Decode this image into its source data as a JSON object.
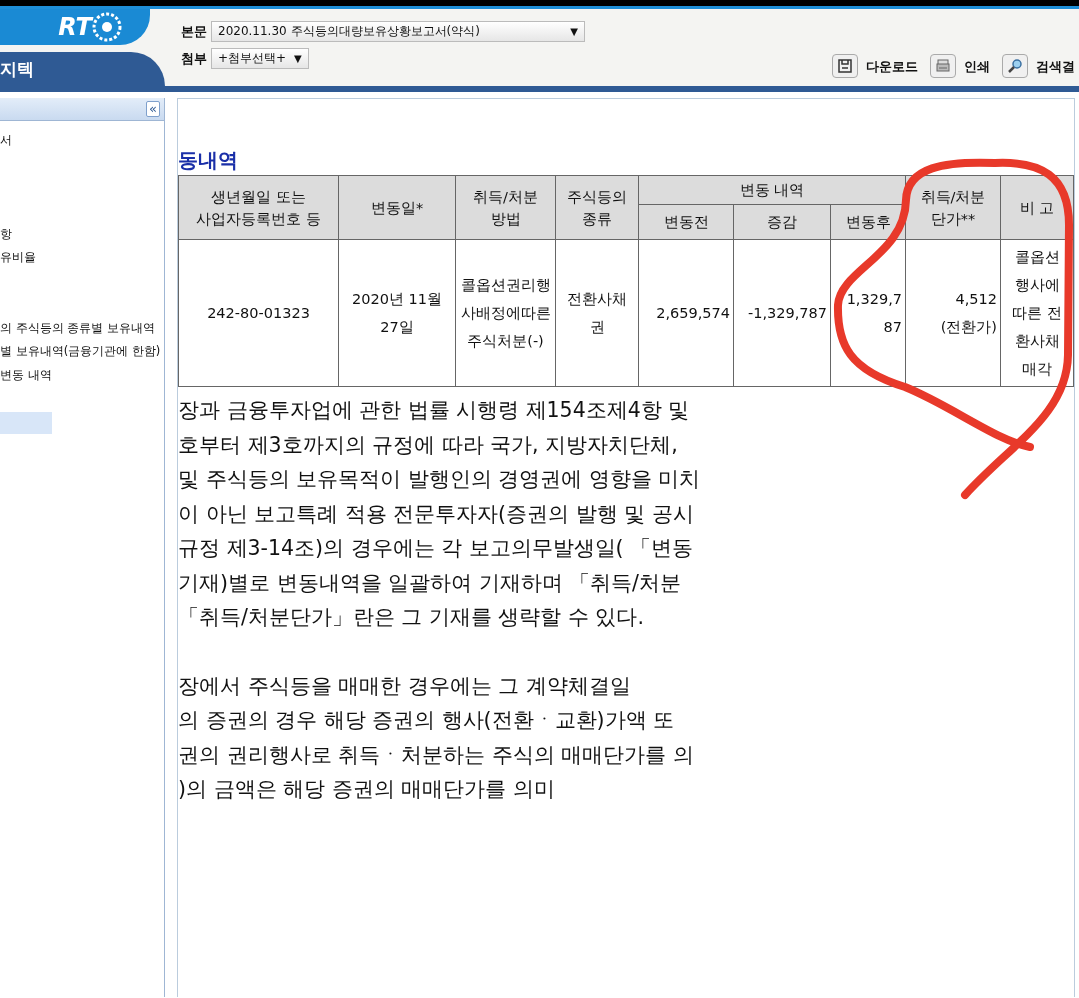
{
  "header": {
    "logo": "RT",
    "company": "지텍",
    "body_label": "본문",
    "body_select": "2020.11.30  주식등의대량보유상황보고서(약식)",
    "attach_label": "첨부",
    "attach_select": "+첨부선택+",
    "select_caret": "▼",
    "actions": [
      {
        "kind": "save",
        "label": "다운로드"
      },
      {
        "kind": "print",
        "label": "인쇄"
      },
      {
        "kind": "search",
        "label": "검색결"
      }
    ]
  },
  "sidebar": {
    "collapse": "«",
    "items": [
      {
        "label": "서"
      },
      {
        "label": "항"
      },
      {
        "label": "유비율"
      },
      {
        "label": "의 주식등의 종류별 보유내역"
      },
      {
        "label": "별 보유내역(금융기관에 한함)"
      },
      {
        "label": "변동 내역"
      }
    ]
  },
  "section_title": "동내역",
  "table": {
    "header_top": [
      {
        "label": "생년월일 또는\n사업자등록번호 등",
        "rowspan": 2
      },
      {
        "label": "변동일*",
        "rowspan": 2
      },
      {
        "label": "취득/처분\n방법",
        "rowspan": 2
      },
      {
        "label": "주식등의\n종류",
        "rowspan": 2
      },
      {
        "label": "변동 내역",
        "colspan": 3
      },
      {
        "label": "취득/처분\n단가**",
        "rowspan": 2
      },
      {
        "label": "비 고",
        "rowspan": 2
      }
    ],
    "header_sub": [
      "변동전",
      "증감",
      "변동후"
    ],
    "rows": [
      [
        "242-80-01323",
        "2020년 11월\n27일",
        "콜옵션권리행\n사배정에따른\n주식처분(-)",
        "전환사채\n권",
        "2,659,574",
        "-1,329,787",
        "1,329,7\n87",
        "4,512\n(전환가)",
        "콜옵션\n행사에\n따른 전\n환사채\n매각"
      ]
    ]
  },
  "notes": [
    [
      "장과 금융투자업에 관한 법률 시행령 제154조제4항 및",
      "호부터 제3호까지의 규정에 따라 국가, 지방자치단체,",
      "및 주식등의 보유목적이 발행인의 경영권에 영향을 미치",
      "이 아닌 보고특례 적용 전문투자자(증권의 발행 및 공시",
      "규정 제3-14조)의 경우에는 각 보고의무발생일( 「변동",
      "기재)별로 변동내역을 일괄하여 기재하며 「취득/처분",
      "「취득/처분단가」란은 그 기재를 생략할 수 있다."
    ],
    [
      "장에서 주식등을 매매한 경우에는 그 계약체결일",
      "의 증권의 경우 해당 증권의 행사(전환ㆍ교환)가액 또",
      "권의 권리행사로 취득ㆍ처분하는 주식의 매매단가를 의",
      ")의 금액은 해당 증권의 매매단가를 의미"
    ]
  ]
}
